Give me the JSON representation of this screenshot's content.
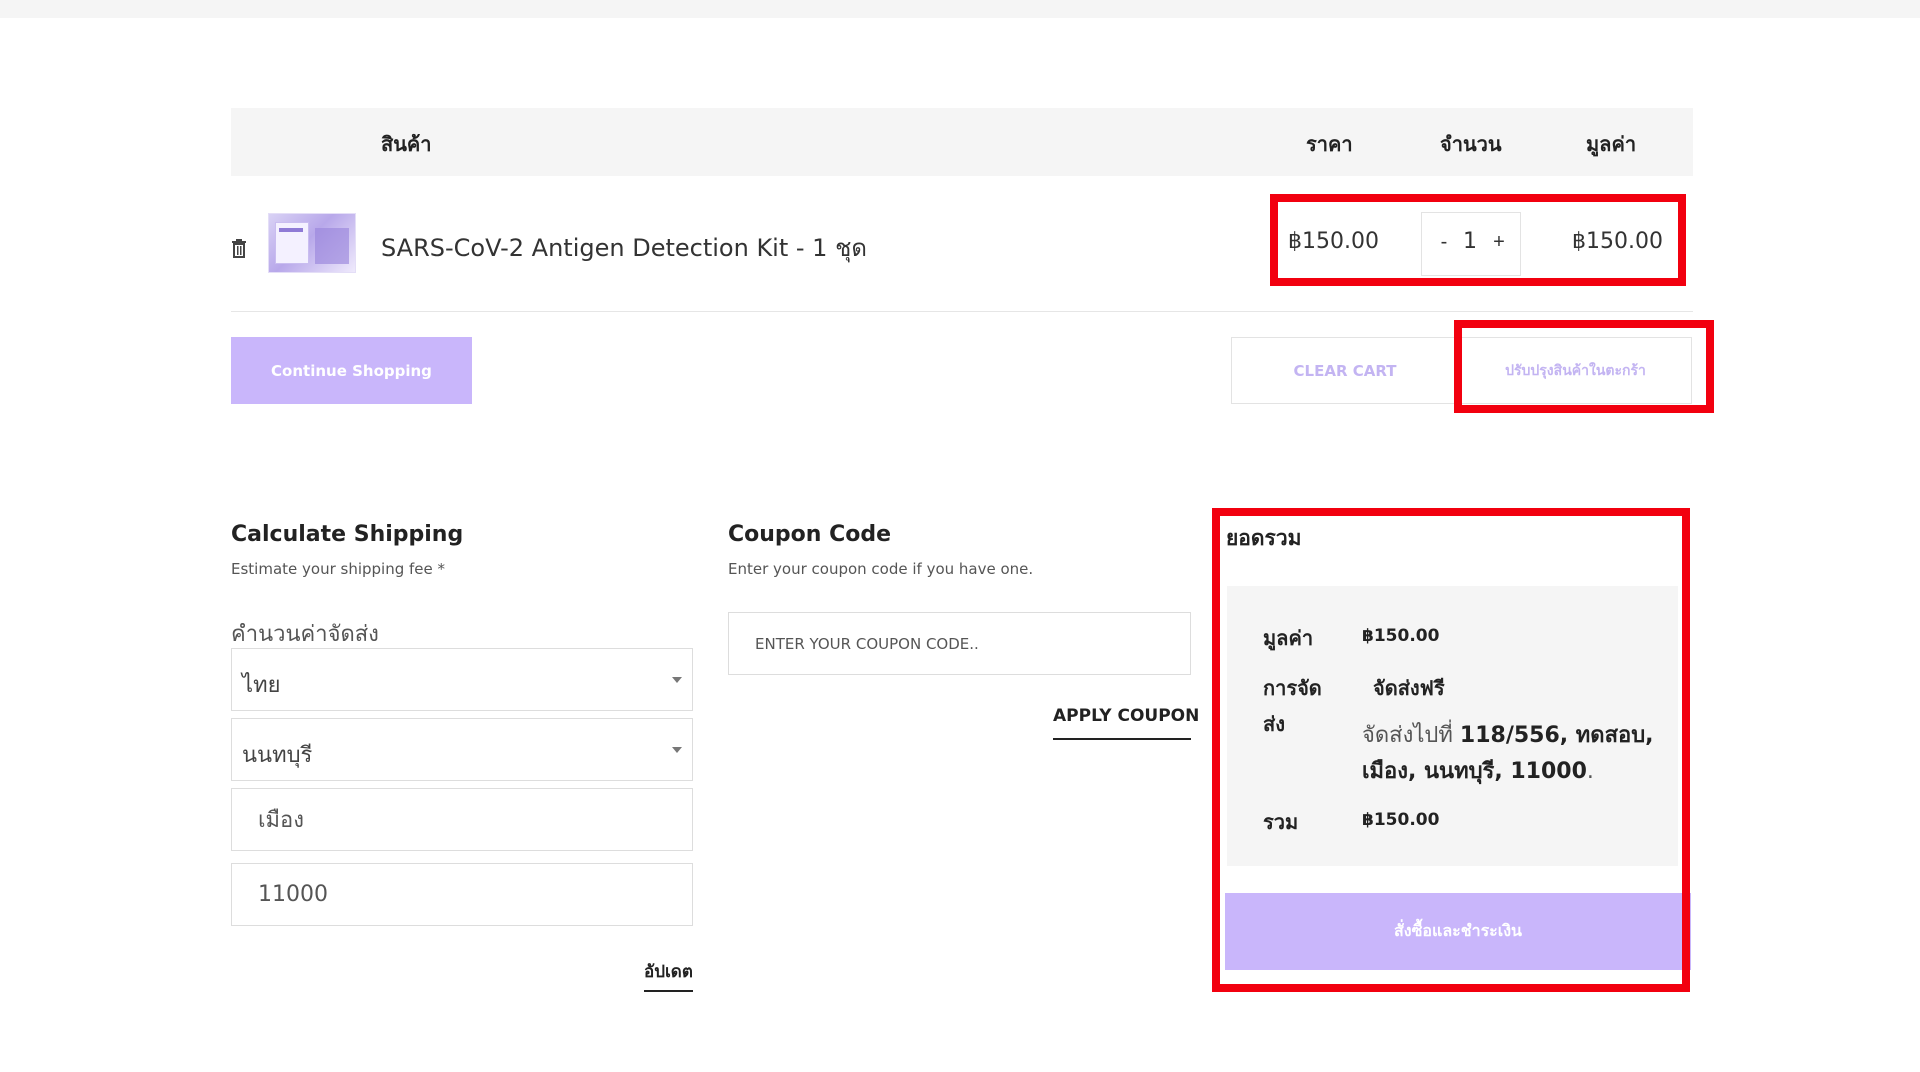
{
  "cart": {
    "headers": {
      "product": "สินค้า",
      "price": "ราคา",
      "quantity": "จำนวน",
      "total": "มูลค่า"
    },
    "items": [
      {
        "name": "SARS-CoV-2 Antigen Detection Kit - 1 ชุด",
        "price": "฿150.00",
        "qty": "1",
        "qty_minus": "-",
        "qty_plus": "+",
        "total": "฿150.00"
      }
    ],
    "continue_label": "Continue Shopping",
    "clear_label": "CLEAR CART",
    "update_label": "ปรับปรุงสินค้าในตะกร้า"
  },
  "shipping": {
    "title": "Calculate Shipping",
    "subtitle": "Estimate your shipping fee *",
    "label": "คำนวนค่าจัดส่ง",
    "country": "ไทย",
    "province": "นนทบุรี",
    "city": "เมือง",
    "postcode": "11000",
    "update_label": "อัปเดต"
  },
  "coupon": {
    "title": "Coupon Code",
    "subtitle": "Enter your coupon code if you have one.",
    "placeholder": "ENTER YOUR COUPON CODE..",
    "apply_label": "APPLY COUPON"
  },
  "totals": {
    "title": "ยอดรวม",
    "subtotal_label": "มูลค่า",
    "subtotal_value": "฿150.00",
    "shipping_label_1": "การจัด",
    "shipping_label_2": "ส่ง",
    "shipping_method": "จัดส่งฟรี",
    "ship_to_prefix": "จัดส่งไปที่",
    "ship_to_address": "118/556, ทดสอบ, เมือง, นนทบุรี, 11000",
    "ship_to_suffix": ".",
    "total_label": "รวม",
    "total_value": "฿150.00",
    "checkout_label": "สั่งซื้อและชำระเงิน"
  },
  "colors": {
    "accent": "#c9b6fb",
    "highlight": "#f2000f",
    "header_bg": "#f5f5f5"
  },
  "icons": {
    "delete": "trash-icon",
    "select": "chevron-down-icon"
  }
}
